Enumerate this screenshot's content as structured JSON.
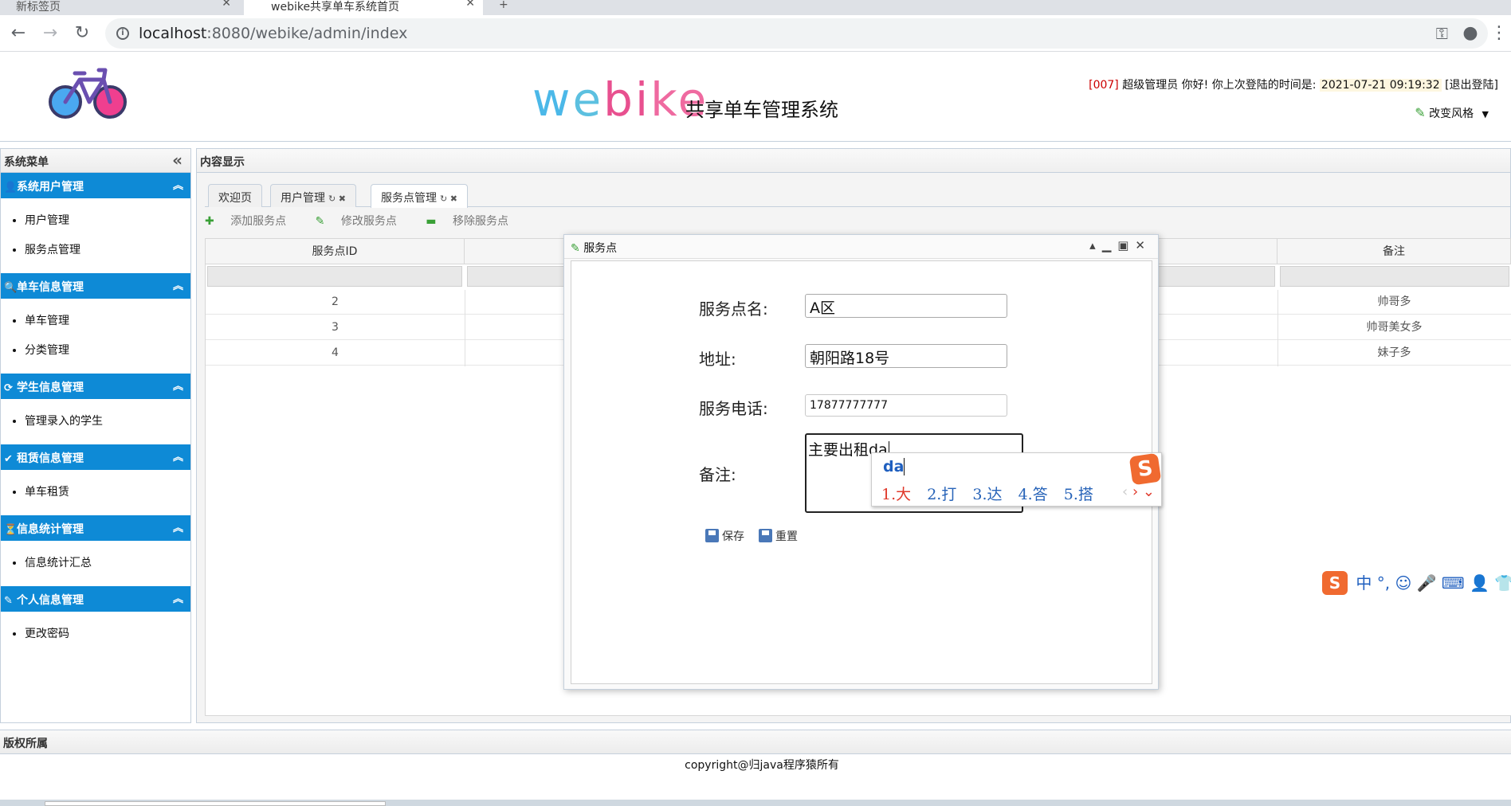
{
  "browser": {
    "tabs": [
      {
        "label": "新标签页"
      },
      {
        "label": "webike共享单车系统首页"
      }
    ],
    "new_tab_label": "+",
    "url_host": "localhost",
    "url_path": ":8080/webike/admin/index"
  },
  "header": {
    "logo_text": "webike",
    "logo_subtitle": "共享单车管理系统",
    "user_code": "[007]",
    "user_greeting": "超级管理员 你好! 你上次登陆的时间是:",
    "last_login": "2021-07-21 09:19:32",
    "logout": "[退出登陆]",
    "change_theme": "改变风格"
  },
  "west": {
    "title": "系统菜单",
    "sections": [
      {
        "title": "系统用户管理",
        "icon": "user-icon",
        "items": [
          "用户管理",
          "服务点管理"
        ]
      },
      {
        "title": "单车信息管理",
        "icon": "search-icon",
        "items": [
          "单车管理",
          "分类管理"
        ]
      },
      {
        "title": "学生信息管理",
        "icon": "refresh-icon",
        "items": [
          "管理录入的学生"
        ]
      },
      {
        "title": "租赁信息管理",
        "icon": "check-icon",
        "items": [
          "单车租赁"
        ]
      },
      {
        "title": "信息统计管理",
        "icon": "chart-icon",
        "items": [
          "信息统计汇总"
        ]
      },
      {
        "title": "个人信息管理",
        "icon": "pencil-icon",
        "items": [
          "更改密码"
        ]
      }
    ]
  },
  "center": {
    "title": "内容显示",
    "tabs": [
      {
        "label": "欢迎页"
      },
      {
        "label": "用户管理"
      },
      {
        "label": "服务点管理"
      }
    ],
    "toolbar": {
      "add": "添加服务点",
      "edit": "修改服务点",
      "remove": "移除服务点"
    },
    "grid": {
      "columns": [
        "服务点ID",
        "备注"
      ],
      "rows": [
        {
          "id": "2",
          "remark": "帅哥多"
        },
        {
          "id": "3",
          "remark": "帅哥美女多"
        },
        {
          "id": "4",
          "remark": "妹子多"
        }
      ]
    }
  },
  "dialog": {
    "title": "服务点",
    "fields": {
      "name_label": "服务点名:",
      "name_value": "A区",
      "address_label": "地址:",
      "address_value": "朝阳路18号",
      "phone_label": "服务电话:",
      "phone_value": "17877777777",
      "remark_label": "备注:",
      "remark_value": "主要出租da"
    },
    "save": "保存",
    "reset": "重置"
  },
  "ime": {
    "composition": "da",
    "candidates": [
      "1.大",
      "2.打",
      "3.达",
      "4.答",
      "5.搭"
    ],
    "logo": "S",
    "toolbar_mode": "中"
  },
  "south": {
    "title": "版权所属",
    "copyright": "copyright@归java程序猿所有"
  }
}
